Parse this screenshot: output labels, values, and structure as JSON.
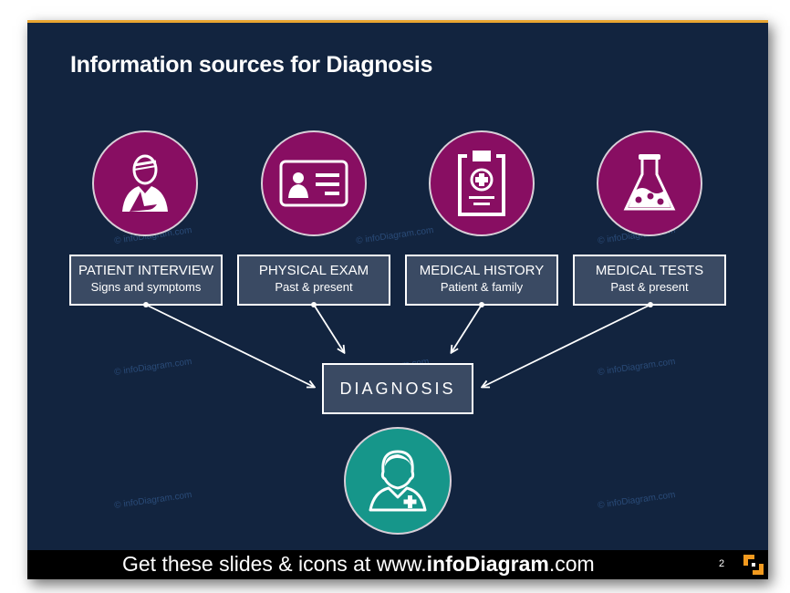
{
  "slide": {
    "title": "Information sources for Diagnosis",
    "watermark": "© infoDiagram.com",
    "sources": [
      {
        "icon": "injured-patient-icon",
        "title": "PATIENT INTERVIEW",
        "subtitle": "Signs and symptoms"
      },
      {
        "icon": "id-card-icon",
        "title": "PHYSICAL EXAM",
        "subtitle": "Past & present"
      },
      {
        "icon": "medical-clipboard-icon",
        "title": "MEDICAL HISTORY",
        "subtitle": "Patient & family"
      },
      {
        "icon": "lab-flask-icon",
        "title": "MEDICAL TESTS",
        "subtitle": "Past & present"
      }
    ],
    "diagnosis_label": "DIAGNOSIS",
    "doctor_icon": "doctor-nurse-icon",
    "colors": {
      "background": "#12243f",
      "source_circle": "#880e62",
      "doctor_circle": "#16968a",
      "accent": "#e8a531",
      "box_fill": "#3a4a63"
    }
  },
  "footer": {
    "text_prefix": "Get these slides & icons at www.",
    "text_brand": "infoDiagram",
    "text_suffix": ".com",
    "page_number": "2"
  }
}
